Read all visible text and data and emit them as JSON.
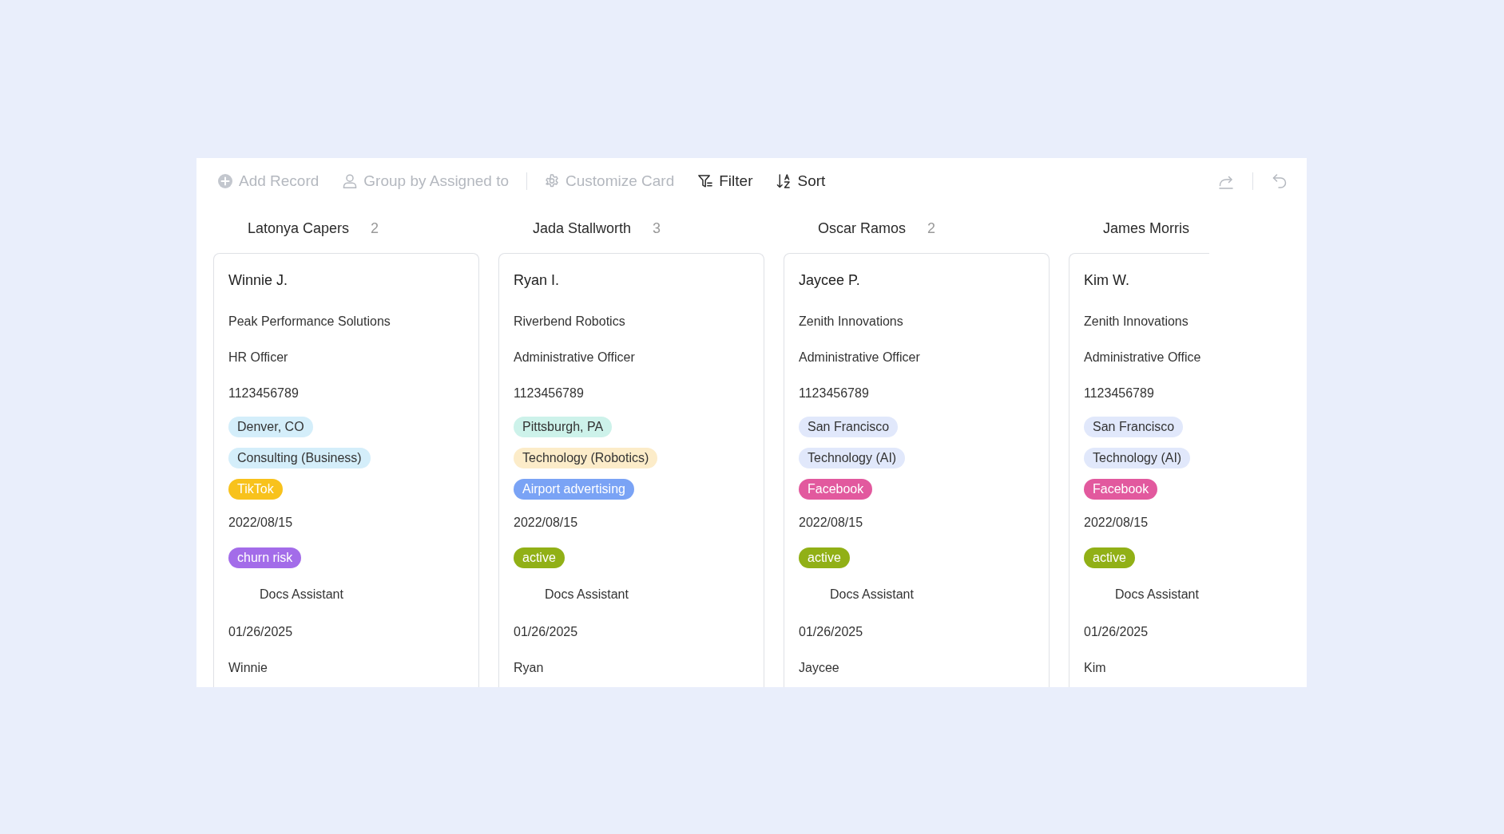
{
  "toolbar": {
    "groups": [
      [
        {
          "kind": "add",
          "label": "Add Record",
          "disabled": true
        },
        {
          "kind": "group",
          "label": "Group by Assigned to",
          "disabled": true
        }
      ],
      [
        {
          "kind": "customize",
          "label": "Customize Card",
          "disabled": true
        },
        {
          "kind": "filter",
          "label": "Filter",
          "disabled": false
        },
        {
          "kind": "sort",
          "label": "Sort",
          "disabled": false
        }
      ]
    ]
  },
  "columns": [
    {
      "name": "Latonya Capers",
      "count": "2",
      "card": {
        "title": "Winnie J.",
        "fields": [
          {
            "kind": "text",
            "value": "Peak Performance Solutions"
          },
          {
            "kind": "text",
            "value": "HR Officer"
          },
          {
            "kind": "text",
            "value": "1123456789"
          },
          {
            "kind": "tag",
            "value": "Denver, CO",
            "color": "#d4eefa"
          },
          {
            "kind": "tag",
            "value": "Consulting (Business)",
            "color": "#d4eefa"
          },
          {
            "kind": "tag",
            "value": "TikTok",
            "color": "#f8c21c"
          },
          {
            "kind": "text",
            "value": "2022/08/15"
          },
          {
            "kind": "tag",
            "value": "churn risk",
            "color": "#a36ce9"
          },
          {
            "kind": "assistant",
            "value": "Docs Assistant"
          },
          {
            "kind": "text",
            "value": "01/26/2025"
          },
          {
            "kind": "text",
            "value": "Winnie"
          }
        ]
      }
    },
    {
      "name": "Jada Stallworth",
      "count": "3",
      "card": {
        "title": "Ryan I.",
        "fields": [
          {
            "kind": "text",
            "value": "Riverbend Robotics"
          },
          {
            "kind": "text",
            "value": "Administrative Officer"
          },
          {
            "kind": "text",
            "value": "1123456789"
          },
          {
            "kind": "tag",
            "value": "Pittsburgh, PA",
            "color": "#cdf2ea"
          },
          {
            "kind": "tag",
            "value": "Technology (Robotics)",
            "color": "#fcecc9"
          },
          {
            "kind": "tag",
            "value": "Airport advertising",
            "color": "#7aa3f5"
          },
          {
            "kind": "text",
            "value": "2022/08/15"
          },
          {
            "kind": "tag",
            "value": "active",
            "color": "#91b016"
          },
          {
            "kind": "assistant",
            "value": "Docs Assistant"
          },
          {
            "kind": "text",
            "value": "01/26/2025"
          },
          {
            "kind": "text",
            "value": "Ryan"
          }
        ]
      }
    },
    {
      "name": "Oscar Ramos",
      "count": "2",
      "card": {
        "title": "Jaycee P.",
        "fields": [
          {
            "kind": "text",
            "value": "Zenith Innovations"
          },
          {
            "kind": "text",
            "value": "Administrative Officer"
          },
          {
            "kind": "text",
            "value": "1123456789"
          },
          {
            "kind": "tag",
            "value": "San Francisco",
            "color": "#e1e8fb"
          },
          {
            "kind": "tag",
            "value": "Technology (AI)",
            "color": "#e1e8fb"
          },
          {
            "kind": "tag",
            "value": "Facebook",
            "color": "#e2599e"
          },
          {
            "kind": "text",
            "value": "2022/08/15"
          },
          {
            "kind": "tag",
            "value": "active",
            "color": "#91b016"
          },
          {
            "kind": "assistant",
            "value": "Docs Assistant"
          },
          {
            "kind": "text",
            "value": "01/26/2025"
          },
          {
            "kind": "text",
            "value": "Jaycee"
          }
        ]
      }
    },
    {
      "name": "James Morris",
      "card": {
        "title": "Kim W.",
        "fields": [
          {
            "kind": "text",
            "value": "Zenith Innovations"
          },
          {
            "kind": "text",
            "value": "Administrative Office"
          },
          {
            "kind": "text",
            "value": "1123456789"
          },
          {
            "kind": "tag",
            "value": "San Francisco",
            "color": "#e1e8fb"
          },
          {
            "kind": "tag",
            "value": "Technology (AI)",
            "color": "#e1e8fb"
          },
          {
            "kind": "tag",
            "value": "Facebook",
            "color": "#e2599e"
          },
          {
            "kind": "text",
            "value": "2022/08/15"
          },
          {
            "kind": "tag",
            "value": "active",
            "color": "#91b016"
          },
          {
            "kind": "assistant",
            "value": "Docs Assistant"
          },
          {
            "kind": "text",
            "value": "01/26/2025"
          },
          {
            "kind": "text",
            "value": "Kim"
          }
        ]
      }
    }
  ]
}
